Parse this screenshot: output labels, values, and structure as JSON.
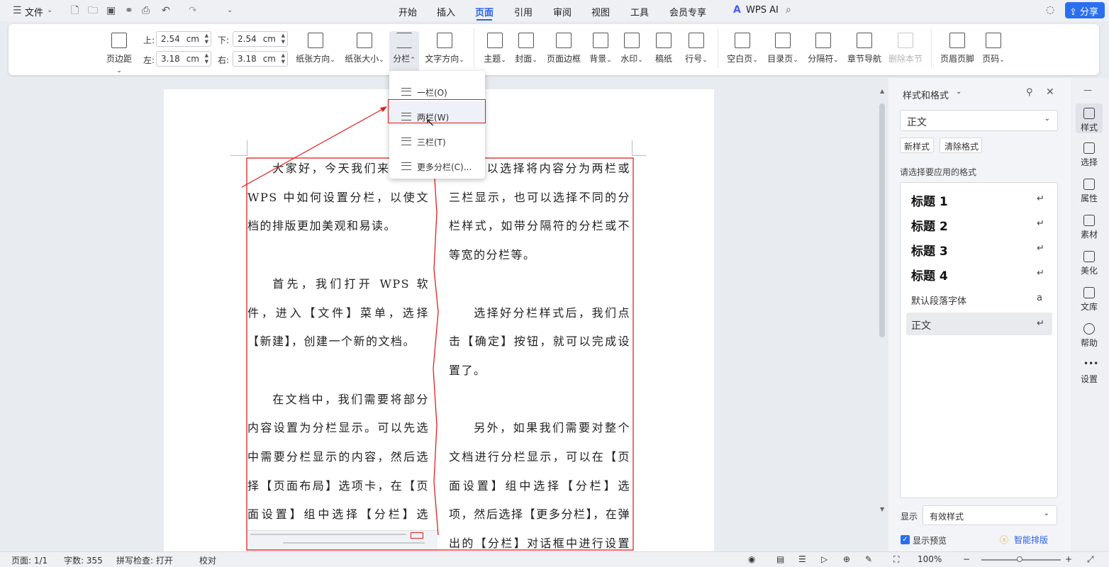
{
  "topbar": {
    "menu": "文件",
    "tabs": [
      "开始",
      "插入",
      "页面",
      "引用",
      "审阅",
      "视图",
      "工具",
      "会员专享"
    ],
    "active_tab": "页面",
    "wps_ai": "WPS AI",
    "share": "分享"
  },
  "ribbon": {
    "margins_label": "页边距",
    "top_label": "上:",
    "top_value": "2.54",
    "bottom_label": "下:",
    "bottom_value": "2.54",
    "left_label": "左:",
    "left_value": "3.18",
    "right_label": "右:",
    "right_value": "3.18",
    "unit": "cm",
    "buttons": [
      "纸张方向",
      "纸张大小",
      "分栏",
      "文字方向",
      "主题",
      "封面",
      "页面边框",
      "背景",
      "水印",
      "稿纸",
      "行号",
      "空白页",
      "目录页",
      "分隔符",
      "章节导航",
      "删除本节",
      "页眉页脚",
      "页码"
    ]
  },
  "dropdown": {
    "items": [
      "一栏(O)",
      "两栏(W)",
      "三栏(T)",
      "更多分栏(C)..."
    ],
    "highlighted": "两栏(W)"
  },
  "document": {
    "col1": [
      "大家好，今天我们来聊一下 WPS 中如何设置分栏，以使文档的排版更加美观和易读。",
      "首先，我们打开 WPS 软件，进入【文件】菜单，选择【新建】，创建一个新的文档。",
      "在文档中，我们需要将部分内容设置为分栏显示。可以先选中需要分栏显示的内容，然后选择【页面布局】选项卡，在【页面设置】组中选择【分栏】选项。"
    ],
    "col2": [
      "可以选择将内容分为两栏或三栏显示，也可以选择不同的分栏样式，如带分隔符的分栏或不等宽的分栏等。",
      "选择好分栏样式后，我们点击【确定】按钮，就可以完成设置了。",
      "另外，如果我们需要对整个文档进行分栏显示，可以在【页面设置】组中选择【分栏】选项，然后选择【更多分栏】，在弹出的【分栏】对话框中进行设置即可。"
    ]
  },
  "panel": {
    "title": "样式和格式",
    "current_style": "正文",
    "new_style": "新样式",
    "clear_format": "清除格式",
    "prompt": "请选择要应用的格式",
    "styles": [
      "标题 1",
      "标题 2",
      "标题 3",
      "标题 4"
    ],
    "default_font": "默认段落字体",
    "body": "正文",
    "show_label": "显示",
    "show_value": "有效样式",
    "preview_label": "显示预览",
    "smart_layout": "智能排版"
  },
  "sidebar": [
    "样式",
    "选择",
    "属性",
    "素材",
    "美化",
    "文库",
    "帮助",
    "设置"
  ],
  "status": {
    "page": "页面: 1/1",
    "words": "字数: 355",
    "spell": "拼写检查: 打开",
    "proof": "校对",
    "zoom": "100%"
  },
  "colors": {
    "accent": "#2b5fe8",
    "annotation": "#e02020"
  }
}
